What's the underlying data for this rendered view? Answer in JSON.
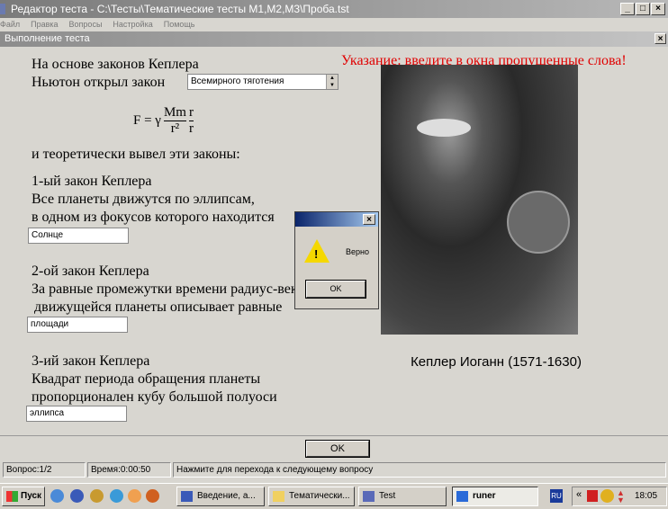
{
  "window": {
    "title": "Редактор теста - C:\\Тесты\\Тематические тесты М1,М2,М3\\Проба.tst",
    "menu": [
      "Файл",
      "Правка",
      "Вопросы",
      "Настройка",
      "Помощь"
    ]
  },
  "dialog_window": {
    "title": "Выполнение теста"
  },
  "hint": "Указание: введите в окна пропущенные слова!",
  "question": {
    "intro1": "На основе законов Кеплера",
    "intro2": "Ньютон открыл закон",
    "answer0": "Всемирного тяготения",
    "formula": {
      "lhs": "F = γ",
      "num": "Mm",
      "den": "r²",
      "vnum": "r",
      "vden": "r"
    },
    "intro3": "и теоретически вывел эти законы:",
    "law1": [
      "1-ый закон Кеплера",
      "Все планеты движутся по эллипсам,",
      "в одном из фокусов которого находится"
    ],
    "answer1": "Солнце",
    "law2": [
      "2-ой закон Кеплера",
      "За равные промежутки времени радиус-вектор",
      "движущейся планеты описывает равные"
    ],
    "answer2": "площади",
    "law3": [
      "3-ий закон Кеплера",
      "Квадрат периода обращения планеты",
      "пропорционален кубу большой полуоси"
    ],
    "answer3": "эллипса"
  },
  "portrait": {
    "caption": "Кеплер Иоганн (1571-1630)"
  },
  "messagebox": {
    "text": "Верно",
    "ok": "OK"
  },
  "ok_button": "OK",
  "statusbar": {
    "question": "Вопрос:1/2",
    "time": "Время:0:00:50",
    "hint": "Нажмите для перехода к следующему вопросу"
  },
  "taskbar": {
    "start": "Пуск",
    "tasks": [
      "Введение, а...",
      "Тематически...",
      "Test",
      "runer"
    ],
    "lang": "RU",
    "clock": "18:05"
  }
}
